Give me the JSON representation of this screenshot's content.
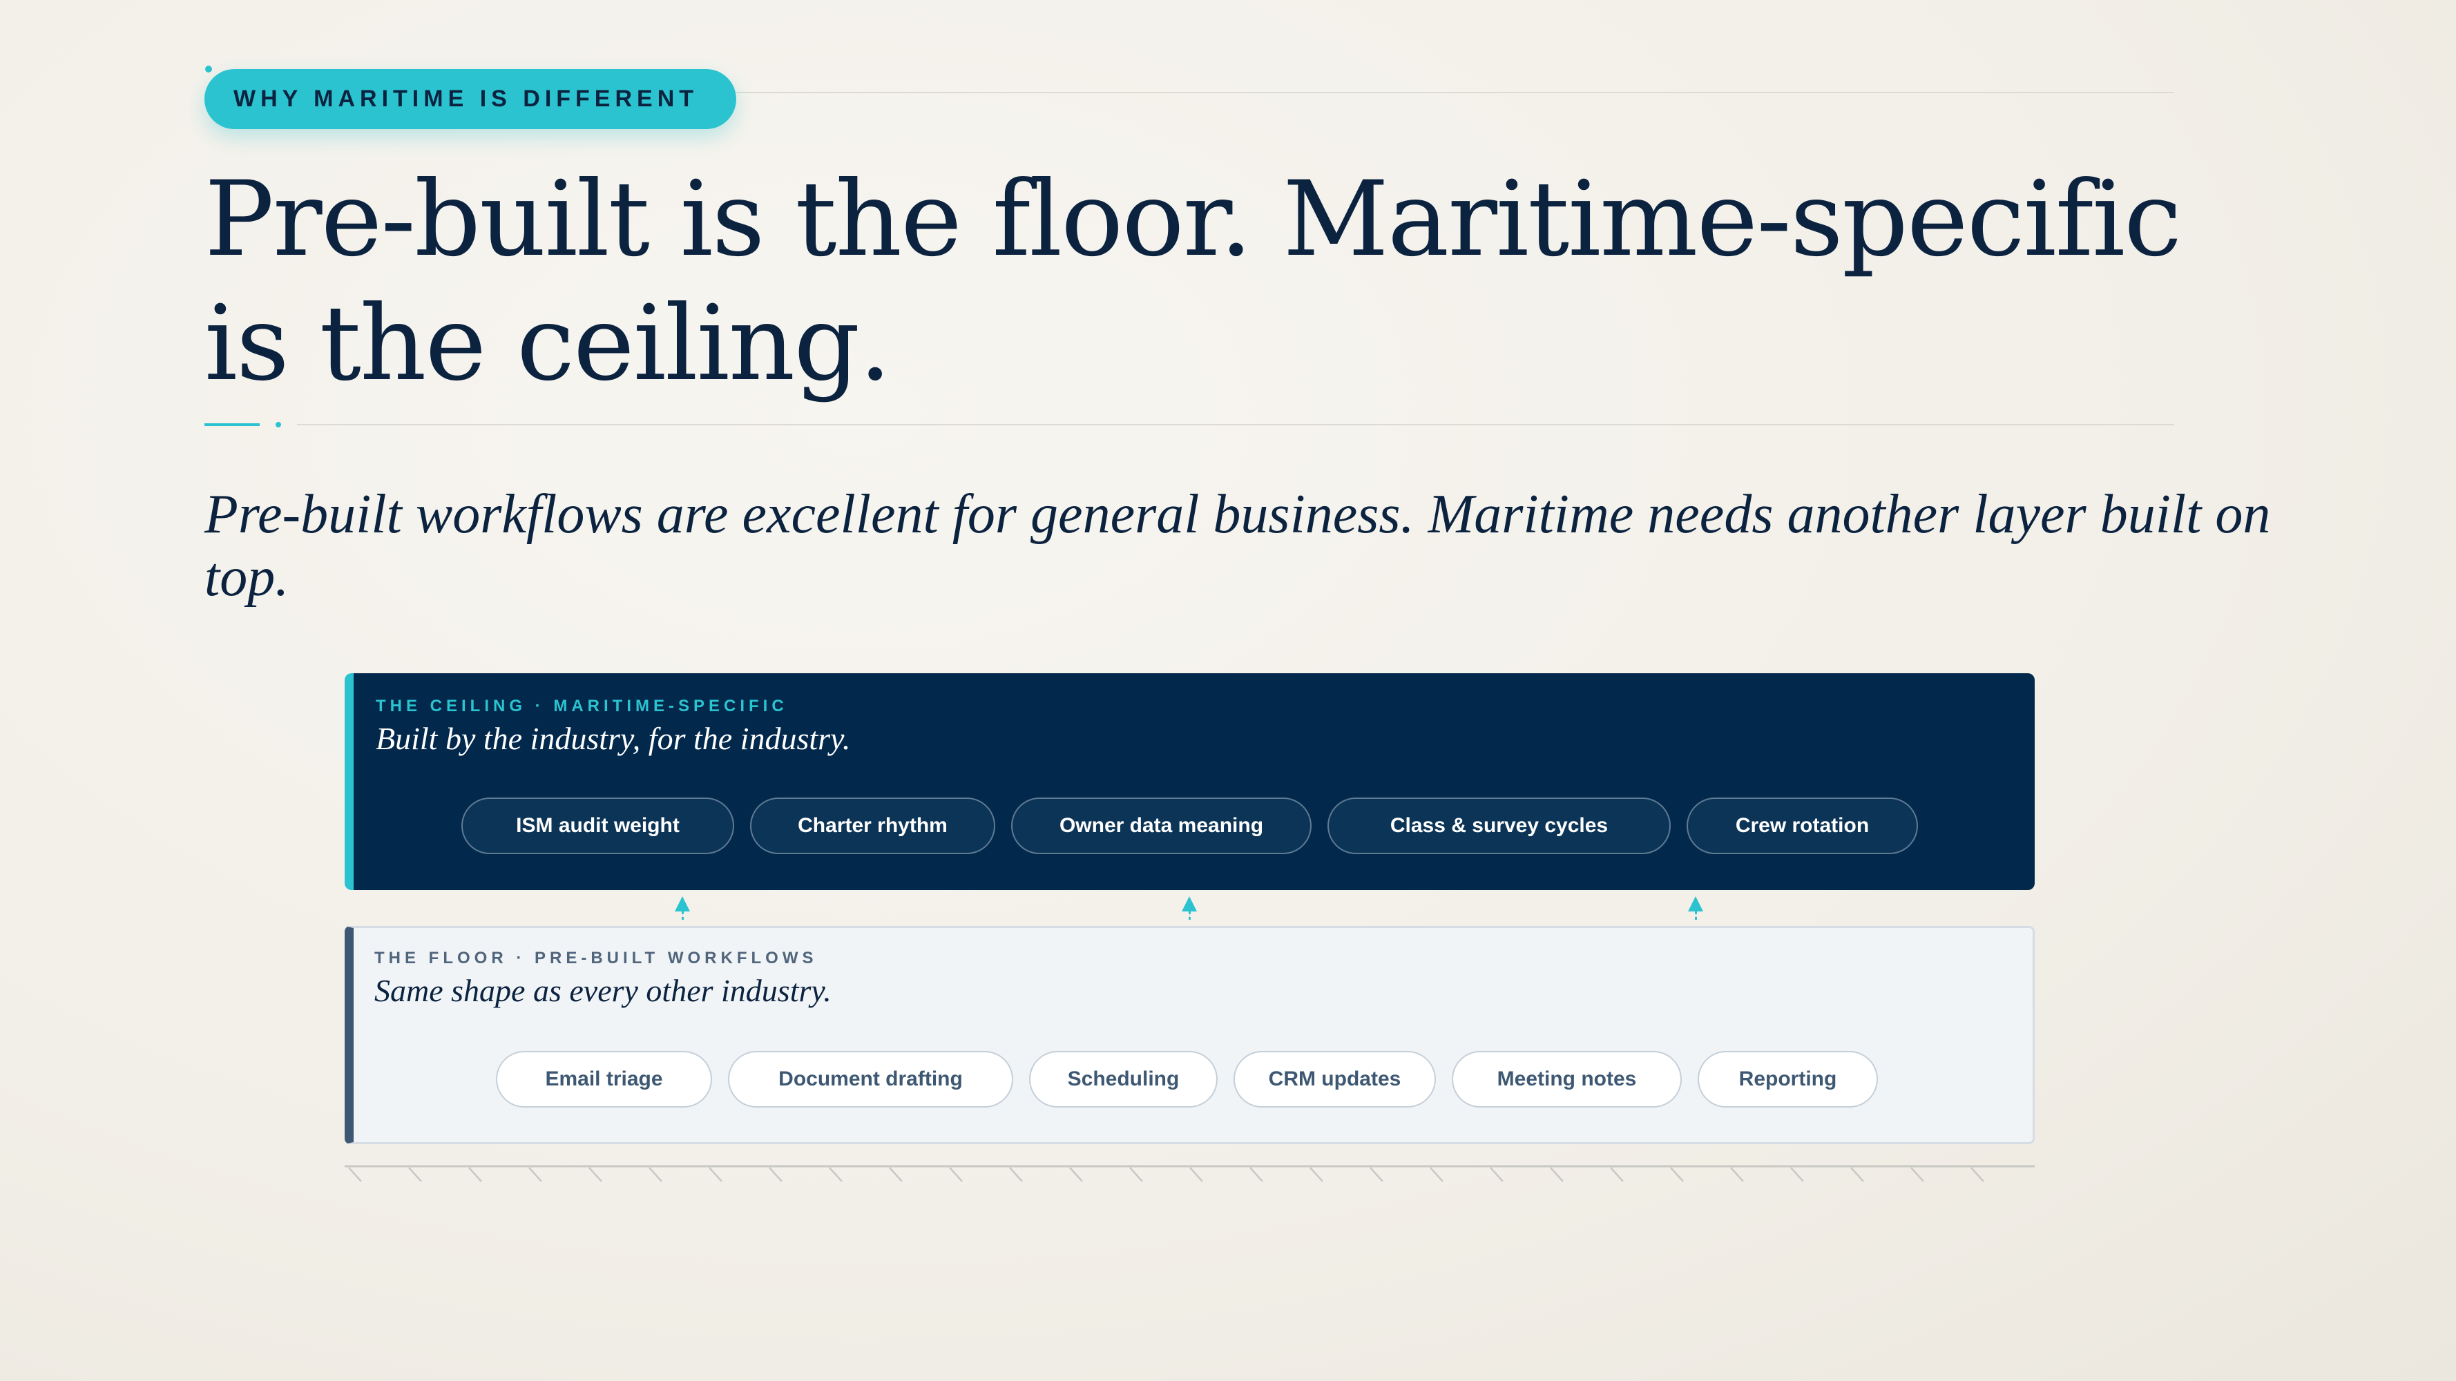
{
  "header": {
    "badge": "WHY MARITIME IS DIFFERENT",
    "headline": "Pre-built is the floor. Maritime-specific is the ceiling.",
    "subtitle": "Pre-built workflows are excellent for general business. Maritime needs another layer built on top."
  },
  "ceiling": {
    "label": "THE CEILING · MARITIME-SPECIFIC",
    "subtitle": "Built by the industry, for the industry.",
    "items": [
      "ISM audit weight",
      "Charter rhythm",
      "Owner data meaning",
      "Class & survey cycles",
      "Crew rotation"
    ]
  },
  "floor": {
    "label": "THE FLOOR · PRE-BUILT WORKFLOWS",
    "subtitle": "Same shape as every other industry.",
    "items": [
      "Email triage",
      "Document drafting",
      "Scheduling",
      "CRM updates",
      "Meeting notes",
      "Reporting"
    ]
  },
  "colors": {
    "accent": "#2bc3cf",
    "navy": "#02294c",
    "ink": "#0c2340",
    "floor_bg": "#f1f4f7"
  }
}
